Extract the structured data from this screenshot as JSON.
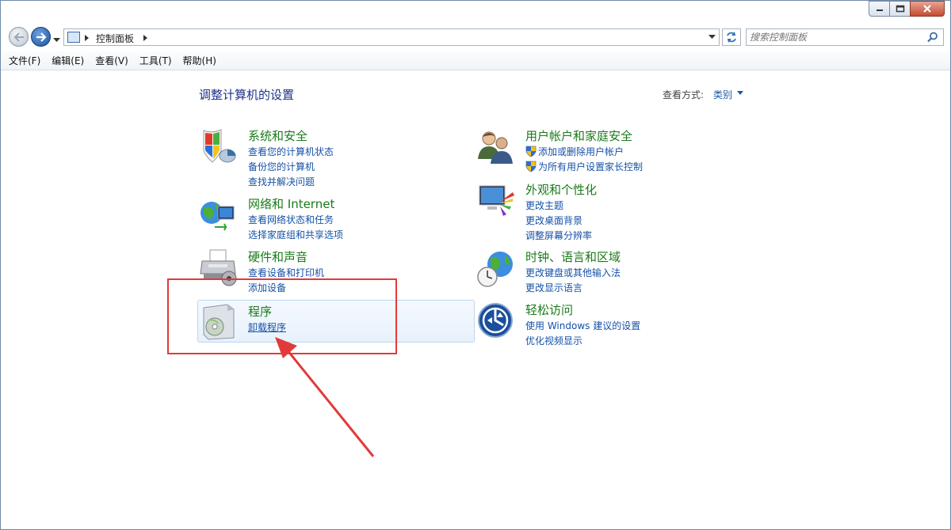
{
  "address": {
    "path": "控制面板"
  },
  "search": {
    "placeholder": "搜索控制面板"
  },
  "menu": [
    "文件(F)",
    "编辑(E)",
    "查看(V)",
    "工具(T)",
    "帮助(H)"
  ],
  "main": {
    "heading": "调整计算机的设置",
    "view_by_label": "查看方式:",
    "view_by_value": "类别"
  },
  "categories": [
    {
      "id": "system-security",
      "icon": "shield-icon",
      "title": "系统和安全",
      "links": [
        "查看您的计算机状态",
        "备份您的计算机",
        "查找并解决问题"
      ]
    },
    {
      "id": "network-internet",
      "icon": "network-icon",
      "title": "网络和 Internet",
      "links": [
        "查看网络状态和任务",
        "选择家庭组和共享选项"
      ]
    },
    {
      "id": "hardware-sound",
      "icon": "printer-icon",
      "title": "硬件和声音",
      "links": [
        "查看设备和打印机",
        "添加设备"
      ]
    },
    {
      "id": "programs",
      "icon": "programs-icon",
      "title": "程序",
      "links": [
        "卸载程序"
      ]
    },
    {
      "id": "user-accounts",
      "icon": "users-icon",
      "title": "用户帐户和家庭安全",
      "links": [
        "添加或删除用户帐户",
        "为所有用户设置家长控制"
      ]
    },
    {
      "id": "appearance",
      "icon": "monitor-icon",
      "title": "外观和个性化",
      "links": [
        "更改主题",
        "更改桌面背景",
        "调整屏幕分辨率"
      ]
    },
    {
      "id": "clock-region",
      "icon": "globe-clock-icon",
      "title": "时钟、语言和区域",
      "links": [
        "更改键盘或其他输入法",
        "更改显示语言"
      ]
    },
    {
      "id": "ease-access",
      "icon": "ease-of-access-icon",
      "title": "轻松访问",
      "links": [
        "使用 Windows 建议的设置",
        "优化视频显示"
      ]
    }
  ],
  "colors": {
    "category_title": "#1a7a1a",
    "link": "#1551a7",
    "heading": "#1e3287",
    "annotation": "#e23a3a"
  }
}
